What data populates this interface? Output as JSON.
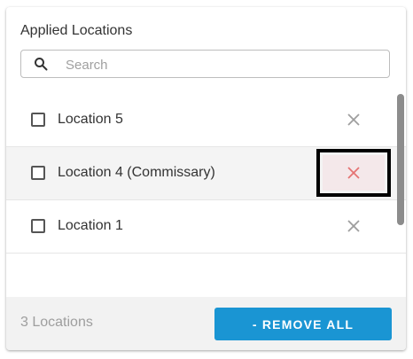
{
  "panel": {
    "title": "Applied Locations",
    "search": {
      "placeholder": "Search",
      "value": ""
    }
  },
  "locations": [
    {
      "label": "Location 5"
    },
    {
      "label": "Location 4 (Commissary)"
    },
    {
      "label": "Location 1"
    }
  ],
  "footer": {
    "count_text": "3 Locations",
    "remove_all_label": "- REMOVE ALL"
  },
  "colors": {
    "accent": "#1a95d3",
    "remove_icon": "#9e9e9e",
    "remove_icon_active": "#e57373"
  },
  "icons": {
    "search": "search-icon",
    "remove": "close-icon"
  }
}
